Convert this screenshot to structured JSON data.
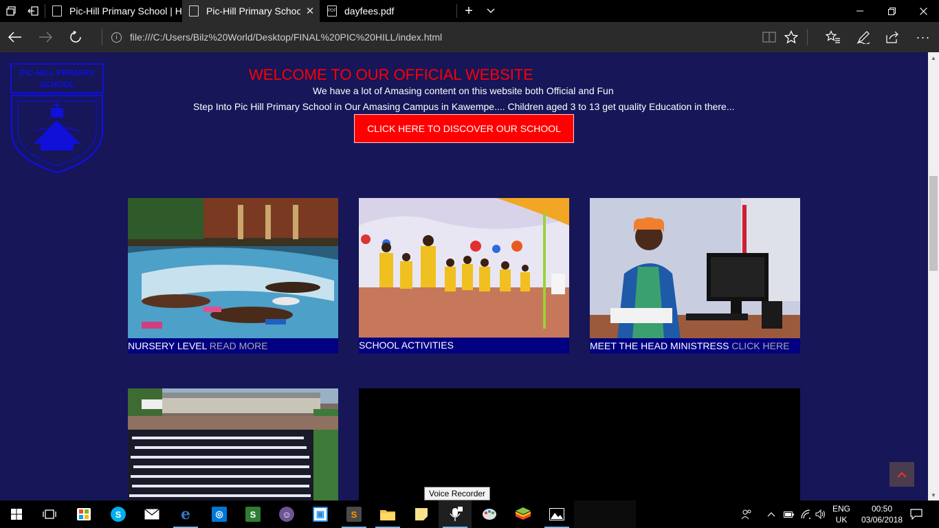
{
  "browser": {
    "tabs": [
      {
        "title": "Pic-Hill Primary School | Ho",
        "active": false,
        "type": "web"
      },
      {
        "title": "Pic-Hill Primary School",
        "active": true,
        "type": "web"
      },
      {
        "title": "dayfees.pdf",
        "active": false,
        "type": "pdf"
      }
    ],
    "address": "file:///C:/Users/Bilz%20World/Desktop/FINAL%20PIC%20HILL/index.html",
    "icons": [
      "tab-set-aside-icon",
      "restore-tabs-icon",
      "new-tab-icon",
      "tab-list-chevron-icon",
      "minimize-icon",
      "maximize-icon",
      "close-icon",
      "back-icon",
      "forward-icon",
      "refresh-icon",
      "info-icon",
      "reading-view-icon",
      "favorite-star-icon",
      "favorites-hub-icon",
      "web-note-icon",
      "share-icon",
      "more-icon"
    ]
  },
  "page": {
    "logo_text": "PIC-HILL PRIMARY SCHOOL",
    "welcome": "WELCOME TO OUR OFFICIAL WEBSITE",
    "subtitle1": "We have a lot of Amasing content on this website both Official and Fun",
    "subtitle2": "Step Into Pic Hill Primary School in Our Amasing Campus in Kawempe.... Children aged 3 to 13 get quality Education in there...",
    "discover_button": "CLICK HERE TO DISCOVER OUR SCHOOL",
    "cards": [
      {
        "caption": "NURSERY LEVEL",
        "link": "READ MORE"
      },
      {
        "caption": "SCHOOL ACTIVITIES",
        "link": ""
      },
      {
        "caption": "MEET THE HEAD MINISTRESS",
        "link": "CLICK HERE"
      }
    ],
    "tooltip": "Voice Recorder",
    "colors": {
      "page_bg": "#161659",
      "welcome": "#ff0000",
      "button": "#ff0000",
      "caption_bg": "#000080",
      "link": "#a9a9a9"
    }
  },
  "taskbar": {
    "apps": [
      "start-icon",
      "task-view-icon",
      "store-icon",
      "skype-icon",
      "mail-icon",
      "edge-icon",
      "camera-icon",
      "sway-icon",
      "github-icon",
      "cortana-app-icon",
      "sublime-icon",
      "file-explorer-icon",
      "sticky-notes-icon",
      "voice-recorder-icon",
      "paint-icon",
      "bluestacks-icon",
      "photos-icon"
    ],
    "lang_top": "ENG",
    "lang_bottom": "UK",
    "time": "00:50",
    "date": "03/06/2018"
  }
}
